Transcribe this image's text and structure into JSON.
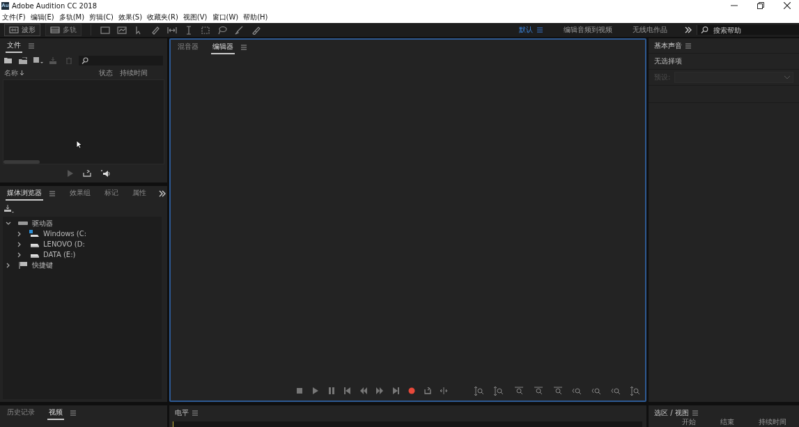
{
  "window": {
    "logo": "Au",
    "title": "Adobe Audition CC 2018"
  },
  "menu": [
    "文件(F)",
    "编辑(E)",
    "多轨(M)",
    "剪辑(C)",
    "效果(S)",
    "收藏夹(R)",
    "视图(V)",
    "窗口(W)",
    "帮助(H)"
  ],
  "toolbar": {
    "modes": [
      {
        "label": "波形",
        "selected": true
      },
      {
        "label": "多轨",
        "selected": false
      }
    ],
    "workspaces": [
      {
        "label": "默认",
        "selected": true
      },
      {
        "label": "编辑音频到视频",
        "selected": false
      },
      {
        "label": "无线电作品",
        "selected": false
      }
    ],
    "search": {
      "placeholder": "搜索帮助"
    }
  },
  "files_panel": {
    "tabs": [
      {
        "label": "文件",
        "selected": true
      }
    ],
    "columns": [
      "名称",
      "状态",
      "持续时间"
    ]
  },
  "media_panel": {
    "tabs": [
      {
        "label": "媒体浏览器",
        "selected": true
      },
      {
        "label": "效果组",
        "selected": false
      },
      {
        "label": "标记",
        "selected": false
      },
      {
        "label": "属性",
        "selected": false
      }
    ],
    "tree": [
      {
        "label": "驱动器",
        "kind": "drives",
        "expanded": true,
        "children": [
          {
            "label": "Windows (C:",
            "kind": "system-disk",
            "expanded": false
          },
          {
            "label": "LENOVO (D:",
            "kind": "disk",
            "expanded": false
          },
          {
            "label": "DATA (E:)",
            "kind": "disk",
            "expanded": false
          }
        ]
      },
      {
        "label": "快捷键",
        "kind": "shortcuts",
        "expanded": false
      }
    ]
  },
  "editor_panel": {
    "tabs": [
      {
        "label": "混音器",
        "selected": false
      },
      {
        "label": "编辑器",
        "selected": true
      }
    ]
  },
  "essential_sound": {
    "title": "基本声音",
    "message": "无选择项",
    "preset_label": "预设:"
  },
  "history_panel": {
    "tabs": [
      {
        "label": "历史记录",
        "selected": false
      },
      {
        "label": "视频",
        "selected": true
      }
    ]
  },
  "levels_panel": {
    "title": "电平"
  },
  "selection_panel": {
    "title": "选区 / 视图",
    "columns": [
      "开始",
      "结束",
      "持续时间"
    ]
  }
}
